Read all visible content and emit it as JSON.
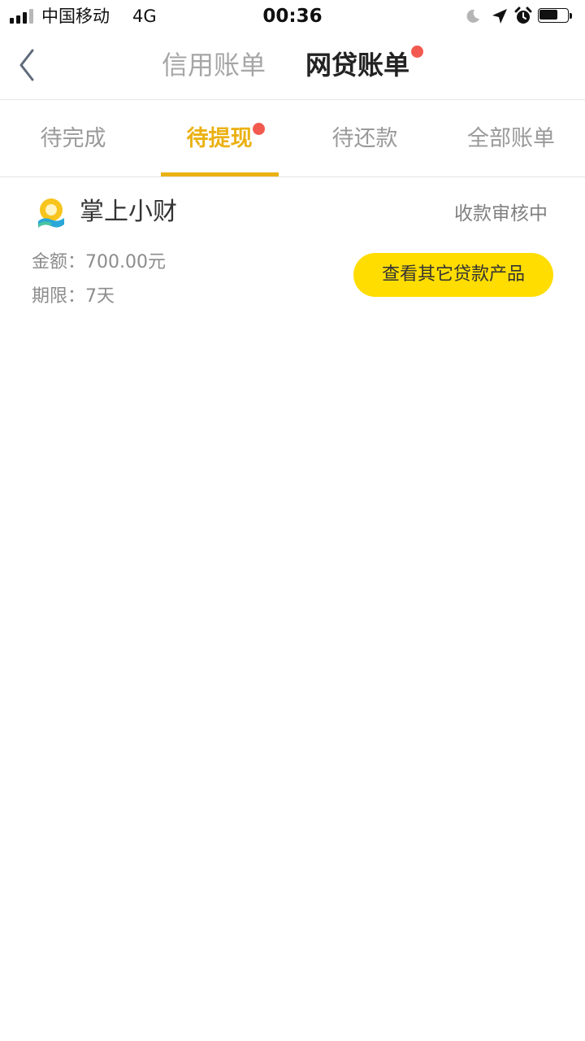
{
  "status_bar": {
    "carrier": "中国移动",
    "network": "4G",
    "time": "00:36",
    "signal_bars": 3,
    "battery_level": 0.65,
    "icons": [
      "signal-icon",
      "moon-icon",
      "location-icon",
      "alarm-icon",
      "battery-icon"
    ]
  },
  "nav": {
    "back_icon": "chevron-left-icon",
    "tabs": [
      {
        "label": "信用账单",
        "active": false
      },
      {
        "label": "网贷账单",
        "active": true,
        "has_dot": true
      }
    ]
  },
  "sub_tabs": [
    {
      "label": "待完成",
      "active": false
    },
    {
      "label": "待提现",
      "active": true,
      "has_dot": true
    },
    {
      "label": "待还款",
      "active": false
    },
    {
      "label": "全部账单",
      "active": false
    }
  ],
  "loan": {
    "product_logo": "product-logo-icon",
    "product_name": "掌上小财",
    "status": "收款审核中",
    "amount_label": "金额：",
    "amount_value": "700.00元",
    "term_label": "期限：",
    "term_value": "7天",
    "button_label": "查看其它贷款产品"
  },
  "colors": {
    "accent": "#ebb113",
    "badge_red": "#f25a50",
    "button_yellow": "#ffdd00",
    "divider": "#e5e5e5",
    "text_muted": "#9a9a9a"
  }
}
